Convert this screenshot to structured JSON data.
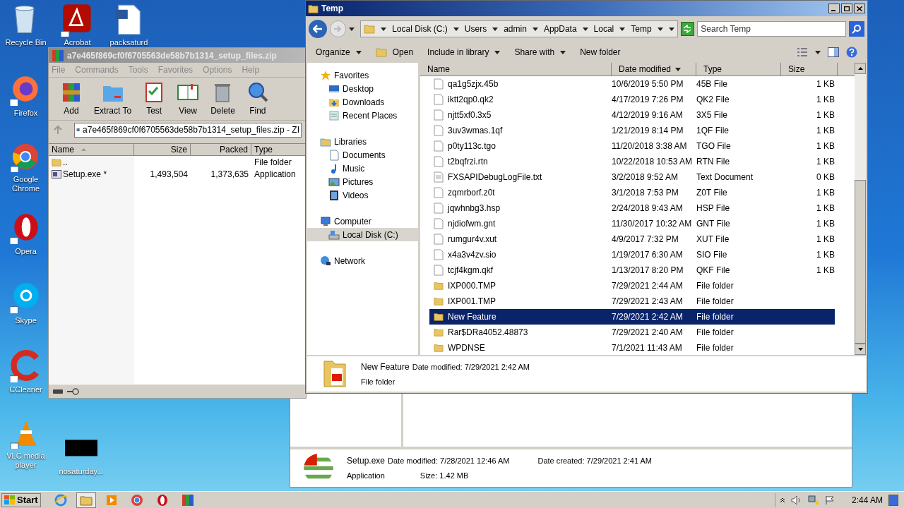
{
  "desktop": {
    "icons_top": [
      {
        "label": "Recycle Bin",
        "kind": "recycle"
      },
      {
        "label": "Acrobat",
        "kind": "acrobat"
      },
      {
        "label": "packsaturd",
        "kind": "word"
      }
    ],
    "icons_left": [
      {
        "label": "Firefox",
        "kind": "firefox"
      },
      {
        "label": "Google Chrome",
        "kind": "chrome"
      },
      {
        "label": "Opera",
        "kind": "opera"
      },
      {
        "label": "Skype",
        "kind": "skype"
      },
      {
        "label": "CCleaner",
        "kind": "ccleaner"
      },
      {
        "label": "VLC media player",
        "kind": "vlc"
      }
    ],
    "icon_bottom": {
      "label": "nosaturday...",
      "kind": "black"
    }
  },
  "back_window": {
    "details": {
      "name": "Setup.exe",
      "modified": "Date modified: 7/28/2021 12:46 AM",
      "created": "Date created: 7/29/2021 2:41 AM",
      "type": "Application",
      "size": "Size: 1.42 MB"
    }
  },
  "winrar": {
    "title": "a7e465f869cf0f6705563de58b7b1314_setup_files.zip",
    "menu": [
      "File",
      "Commands",
      "Tools",
      "Favorites",
      "Options",
      "Help"
    ],
    "toolbar": [
      {
        "label": "Add",
        "kind": "add"
      },
      {
        "label": "Extract To",
        "kind": "extract"
      },
      {
        "label": "Test",
        "kind": "test"
      },
      {
        "label": "View",
        "kind": "view"
      },
      {
        "label": "Delete",
        "kind": "delete"
      },
      {
        "label": "Find",
        "kind": "find"
      }
    ],
    "path": "a7e465f869cf0f6705563de58b7b1314_setup_files.zip - ZI",
    "columns": [
      "Name",
      "Size",
      "Packed",
      "Type"
    ],
    "rows": [
      {
        "kind": "folder",
        "name": "..",
        "size": "",
        "packed": "",
        "type": "File folder"
      },
      {
        "kind": "exe",
        "name": "Setup.exe *",
        "size": "1,493,504",
        "packed": "1,373,635",
        "type": "Application"
      }
    ]
  },
  "explorer": {
    "title": "Temp",
    "breadcrumb": [
      "Local Disk (C:)",
      "Users",
      "admin",
      "AppData",
      "Local",
      "Temp"
    ],
    "search": {
      "placeholder": "Search Temp"
    },
    "toolbar": [
      {
        "label": "Organize",
        "dropdown": true,
        "kind": "plain"
      },
      {
        "label": "Open",
        "dropdown": false,
        "kind": "open"
      },
      {
        "label": "Include in library",
        "dropdown": true,
        "kind": "plain"
      },
      {
        "label": "Share with",
        "dropdown": true,
        "kind": "plain"
      },
      {
        "label": "New folder",
        "dropdown": false,
        "kind": "plain"
      }
    ],
    "nav": [
      {
        "label": "Favorites",
        "kind": "star",
        "selected": false,
        "children": [
          {
            "label": "Desktop",
            "kind": "desktop",
            "selected": false
          },
          {
            "label": "Downloads",
            "kind": "downloads",
            "selected": false
          },
          {
            "label": "Recent Places",
            "kind": "recent",
            "selected": false
          }
        ]
      },
      {
        "label": "Libraries",
        "kind": "libraries",
        "selected": false,
        "children": [
          {
            "label": "Documents",
            "kind": "documents",
            "selected": false
          },
          {
            "label": "Music",
            "kind": "music",
            "selected": false
          },
          {
            "label": "Pictures",
            "kind": "pictures",
            "selected": false
          },
          {
            "label": "Videos",
            "kind": "videos",
            "selected": false
          }
        ]
      },
      {
        "label": "Computer",
        "kind": "computer",
        "selected": false,
        "children": [
          {
            "label": "Local Disk (C:)",
            "kind": "disk",
            "selected": true
          }
        ]
      },
      {
        "label": "Network",
        "kind": "network",
        "selected": false
      }
    ],
    "columns": [
      "Name",
      "Date modified",
      "Type",
      "Size"
    ],
    "rows": [
      {
        "kind": "file",
        "name": "qa1g5zjx.45b",
        "date": "10/6/2019 5:50 PM",
        "type": "45B File",
        "size": "1 KB",
        "selected": false
      },
      {
        "kind": "file",
        "name": "iktt2qp0.qk2",
        "date": "4/17/2019 7:26 PM",
        "type": "QK2 File",
        "size": "1 KB",
        "selected": false
      },
      {
        "kind": "file",
        "name": "njtt5xf0.3x5",
        "date": "4/12/2019 9:16 AM",
        "type": "3X5 File",
        "size": "1 KB",
        "selected": false
      },
      {
        "kind": "file",
        "name": "3uv3wmas.1qf",
        "date": "1/21/2019 8:14 PM",
        "type": "1QF File",
        "size": "1 KB",
        "selected": false
      },
      {
        "kind": "file",
        "name": "p0ty113c.tgo",
        "date": "11/20/2018 3:38 AM",
        "type": "TGO File",
        "size": "1 KB",
        "selected": false
      },
      {
        "kind": "file",
        "name": "t2bqfrzi.rtn",
        "date": "10/22/2018 10:53 AM",
        "type": "RTN File",
        "size": "1 KB",
        "selected": false
      },
      {
        "kind": "text",
        "name": "FXSAPIDebugLogFile.txt",
        "date": "3/2/2018 9:52 AM",
        "type": "Text Document",
        "size": "0 KB",
        "selected": false
      },
      {
        "kind": "file",
        "name": "zqmrborf.z0t",
        "date": "3/1/2018 7:53 PM",
        "type": "Z0T File",
        "size": "1 KB",
        "selected": false
      },
      {
        "kind": "file",
        "name": "jqwhnbg3.hsp",
        "date": "2/24/2018 9:43 AM",
        "type": "HSP File",
        "size": "1 KB",
        "selected": false
      },
      {
        "kind": "file",
        "name": "njdiofwm.gnt",
        "date": "11/30/2017 10:32 AM",
        "type": "GNT File",
        "size": "1 KB",
        "selected": false
      },
      {
        "kind": "file",
        "name": "rumgur4v.xut",
        "date": "4/9/2017 7:32 PM",
        "type": "XUT File",
        "size": "1 KB",
        "selected": false
      },
      {
        "kind": "file",
        "name": "x4a3v4zv.sio",
        "date": "1/19/2017 6:30 AM",
        "type": "SIO File",
        "size": "1 KB",
        "selected": false
      },
      {
        "kind": "file",
        "name": "tcjf4kgm.qkf",
        "date": "1/13/2017 8:20 PM",
        "type": "QKF File",
        "size": "1 KB",
        "selected": false
      },
      {
        "kind": "folder",
        "name": "IXP000.TMP",
        "date": "7/29/2021 2:44 AM",
        "type": "File folder",
        "size": "",
        "selected": false
      },
      {
        "kind": "folder",
        "name": "IXP001.TMP",
        "date": "7/29/2021 2:43 AM",
        "type": "File folder",
        "size": "",
        "selected": false
      },
      {
        "kind": "folder",
        "name": "New Feature",
        "date": "7/29/2021 2:42 AM",
        "type": "File folder",
        "size": "",
        "selected": true
      },
      {
        "kind": "folder",
        "name": "Rar$DRa4052.48873",
        "date": "7/29/2021 2:40 AM",
        "type": "File folder",
        "size": "",
        "selected": false
      },
      {
        "kind": "folder",
        "name": "WPDNSE",
        "date": "7/1/2021 11:43 AM",
        "type": "File folder",
        "size": "",
        "selected": false
      }
    ],
    "details": {
      "name": "New Feature",
      "modified": "Date modified: 7/29/2021 2:42 AM",
      "type": "File folder"
    }
  },
  "taskbar": {
    "start": "Start",
    "apps": [
      {
        "kind": "ie",
        "selected": false
      },
      {
        "kind": "explorer",
        "selected": true
      },
      {
        "kind": "media",
        "selected": false
      },
      {
        "kind": "chrome",
        "selected": false
      },
      {
        "kind": "opera",
        "selected": false
      },
      {
        "kind": "winrar",
        "selected": false
      }
    ],
    "clock": "2:44 AM"
  }
}
